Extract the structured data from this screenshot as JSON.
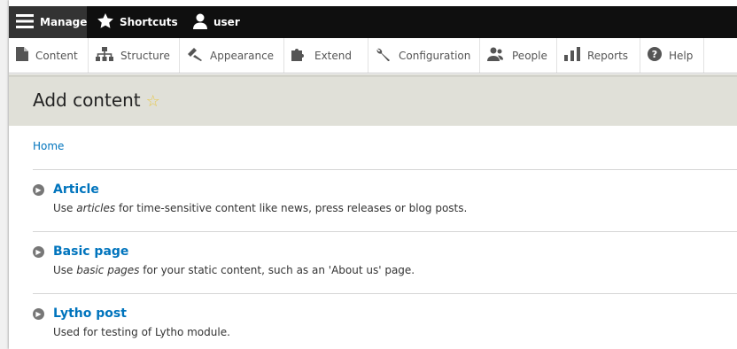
{
  "toolbar": {
    "manage_label": "Manage",
    "shortcuts_label": "Shortcuts",
    "user_label": "user"
  },
  "tray": {
    "items": [
      {
        "label": "Content",
        "icon": "file-icon"
      },
      {
        "label": "Structure",
        "icon": "sitemap-icon"
      },
      {
        "label": "Appearance",
        "icon": "paintbrush-icon"
      },
      {
        "label": "Extend",
        "icon": "puzzle-icon"
      },
      {
        "label": "Configuration",
        "icon": "wrench-icon"
      },
      {
        "label": "People",
        "icon": "people-icon"
      },
      {
        "label": "Reports",
        "icon": "bar-chart-icon"
      },
      {
        "label": "Help",
        "icon": "help-icon"
      }
    ]
  },
  "page": {
    "title": "Add content",
    "breadcrumb": "Home"
  },
  "content_types": [
    {
      "title": "Article",
      "desc_pre": "Use ",
      "desc_em": "articles",
      "desc_post": " for time-sensitive content like news, press releases or blog posts."
    },
    {
      "title": "Basic page",
      "desc_pre": "Use ",
      "desc_em": "basic pages",
      "desc_post": " for your static content, such as an 'About us' page."
    },
    {
      "title": "Lytho post",
      "desc_pre": "Used for testing of Lytho module.",
      "desc_em": "",
      "desc_post": ""
    }
  ],
  "colors": {
    "link": "#0074bd",
    "toolbar_bg": "#0f0f0f",
    "header_bg": "#e0e0d8"
  }
}
